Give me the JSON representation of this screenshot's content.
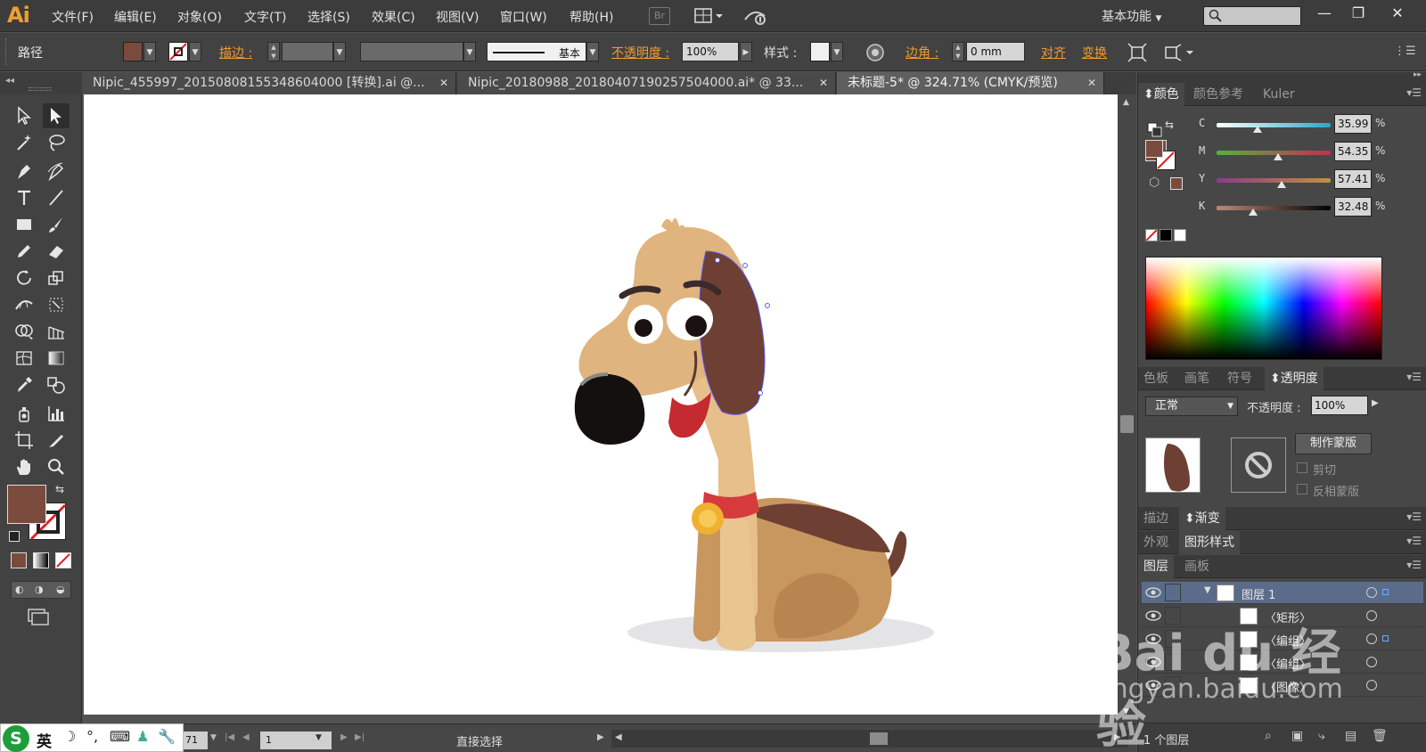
{
  "app": {
    "logo": "Ai"
  },
  "menu": [
    "文件(F)",
    "编辑(E)",
    "对象(O)",
    "文字(T)",
    "选择(S)",
    "效果(C)",
    "视图(V)",
    "窗口(W)",
    "帮助(H)"
  ],
  "menubar": {
    "bridge_label": "Br",
    "workspace": "基本功能",
    "search_placeholder": ""
  },
  "control": {
    "selection_type": "路径",
    "fill_color": "#7a4a3c",
    "stroke_label": "描边 :",
    "brush_label": "基本",
    "opacity_label": "不透明度 :",
    "opacity_value": "100%",
    "style_label": "样式 :",
    "corner_label": "边角 :",
    "corner_value": "0 mm",
    "align_label": "对齐",
    "transform_label": "变换"
  },
  "tabs": [
    {
      "label": "Nipic_455997_20150808155348604000 [转换].ai @...",
      "active": false
    },
    {
      "label": "Nipic_20180988_20180407190257504000.ai* @ 33...",
      "active": false
    },
    {
      "label": "未标题-5* @ 324.71% (CMYK/预览)",
      "active": true
    }
  ],
  "status": {
    "zoom": "71",
    "page": "1",
    "tool_text": "直接选择"
  },
  "ime": {
    "logo": "S",
    "mode": "英"
  },
  "color_panel": {
    "tabs": [
      "颜色",
      "颜色参考",
      "Kuler"
    ],
    "active_tab": "颜色",
    "sliders": [
      {
        "label": "C",
        "value": "35.99",
        "fraction": 0.36,
        "track": "linear-gradient(to right,#ffffff,#2aa8c0)"
      },
      {
        "label": "M",
        "value": "54.35",
        "fraction": 0.54,
        "track": "linear-gradient(to right,#55b040,#c03050)"
      },
      {
        "label": "Y",
        "value": "57.41",
        "fraction": 0.57,
        "track": "linear-gradient(to right,#8a3a8a,#c09040)"
      },
      {
        "label": "K",
        "value": "32.48",
        "fraction": 0.32,
        "track": "linear-gradient(to right,#c08878,#000000)"
      }
    ],
    "percent_sign": "%"
  },
  "transparency_panel": {
    "tabs": [
      "色板",
      "画笔",
      "符号",
      "透明度"
    ],
    "active_tab": "透明度",
    "blend_mode": "正常",
    "opacity_label": "不透明度 :",
    "opacity_value": "100%",
    "make_mask_label": "制作蒙版",
    "clip_label": "剪切",
    "invert_label": "反相蒙版"
  },
  "stroke_panel": {
    "tabs": [
      "描边",
      "渐变"
    ],
    "active_tab": "渐变"
  },
  "appearance_panel": {
    "tabs": [
      "外观",
      "图形样式"
    ],
    "active_tab": "图形样式"
  },
  "layers_panel": {
    "tabs": [
      "图层",
      "画板"
    ],
    "active_tab": "图层",
    "layers": [
      {
        "name": "图层 1",
        "indent": 0,
        "selected": true
      },
      {
        "name": "〈矩形〉",
        "indent": 1,
        "selected": false
      },
      {
        "name": "〈编组〉",
        "indent": 1,
        "selected": false
      },
      {
        "name": "〈编组〉",
        "indent": 1,
        "selected": false
      },
      {
        "name": "〈图像〉",
        "indent": 1,
        "selected": false
      }
    ],
    "footer": "1 个图层"
  },
  "watermark": {
    "brand": "Bai du 经验",
    "url": "jingyan.baidu.com"
  }
}
